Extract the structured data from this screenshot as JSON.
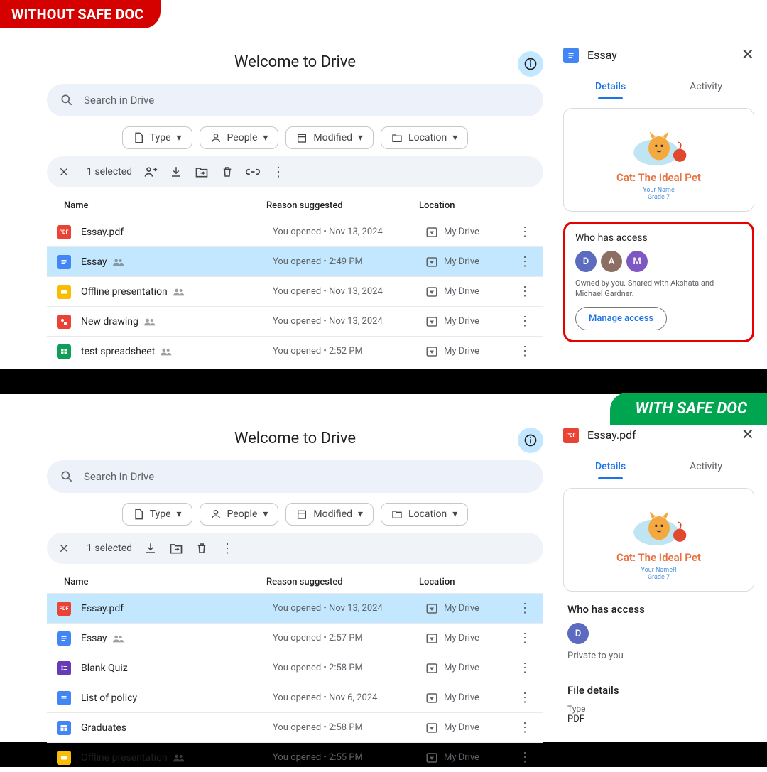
{
  "badges": {
    "without": "WITHOUT SAFE DOC",
    "with": "WITH SAFE DOC"
  },
  "top": {
    "pageTitle": "Welcome to Drive",
    "searchPlaceholder": "Search in Drive",
    "chips": {
      "type": "Type",
      "people": "People",
      "modified": "Modified",
      "location": "Location"
    },
    "selected": "1 selected",
    "headers": {
      "name": "Name",
      "reason": "Reason suggested",
      "location": "Location"
    },
    "rows": [
      {
        "name": "Essay.pdf",
        "reason": "You opened • Nov 13, 2024",
        "location": "My Drive",
        "icon": "pdf",
        "shared": false,
        "selected": false
      },
      {
        "name": "Essay",
        "reason": "You opened • 2:49 PM",
        "location": "My Drive",
        "icon": "doc",
        "shared": true,
        "selected": true
      },
      {
        "name": "Offline presentation",
        "reason": "You opened • Nov 13, 2024",
        "location": "My Drive",
        "icon": "slides",
        "shared": true,
        "selected": false
      },
      {
        "name": "New drawing",
        "reason": "You opened • Nov 13, 2024",
        "location": "My Drive",
        "icon": "draw",
        "shared": true,
        "selected": false
      },
      {
        "name": "test spreadsheet",
        "reason": "You opened • 2:52 PM",
        "location": "My Drive",
        "icon": "sheet",
        "shared": true,
        "selected": false
      }
    ],
    "side": {
      "filename": "Essay",
      "fileicon": "doc",
      "tabs": {
        "details": "Details",
        "activity": "Activity"
      },
      "preview": {
        "title": "Cat: The Ideal Pet",
        "sub1": "Your Name",
        "sub2": "Grade 7"
      },
      "access": {
        "title": "Who has access",
        "avatars": [
          {
            "letter": "D",
            "cls": "av-d"
          },
          {
            "letter": "A",
            "cls": "av-a"
          },
          {
            "letter": "M",
            "cls": "av-m"
          }
        ],
        "text": "Owned by you. Shared with Akshata and Michael Gardner.",
        "manage": "Manage access"
      }
    }
  },
  "bot": {
    "pageTitle": "Welcome to Drive",
    "searchPlaceholder": "Search in Drive",
    "chips": {
      "type": "Type",
      "people": "People",
      "modified": "Modified",
      "location": "Location"
    },
    "selected": "1 selected",
    "headers": {
      "name": "Name",
      "reason": "Reason suggested",
      "location": "Location"
    },
    "rows": [
      {
        "name": "Essay.pdf",
        "reason": "You opened • Nov 13, 2024",
        "location": "My Drive",
        "icon": "pdf",
        "shared": false,
        "selected": true
      },
      {
        "name": "Essay",
        "reason": "You opened • 2:57 PM",
        "location": "My Drive",
        "icon": "doc",
        "shared": true,
        "selected": false
      },
      {
        "name": "Blank Quiz",
        "reason": "You opened • 2:58 PM",
        "location": "My Drive",
        "icon": "form",
        "shared": false,
        "selected": false
      },
      {
        "name": "List of policy",
        "reason": "You opened • Nov 6, 2024",
        "location": "My Drive",
        "icon": "doc",
        "shared": false,
        "selected": false
      },
      {
        "name": "Graduates",
        "reason": "You opened • 2:58 PM",
        "location": "My Drive",
        "icon": "site",
        "shared": false,
        "selected": false
      },
      {
        "name": "Offline presentation",
        "reason": "You opened • 2:55 PM",
        "location": "My Drive",
        "icon": "slides",
        "shared": true,
        "selected": false
      }
    ],
    "side": {
      "filename": "Essay.pdf",
      "fileicon": "pdf",
      "tabs": {
        "details": "Details",
        "activity": "Activity"
      },
      "preview": {
        "title": "Cat: The Ideal Pet",
        "sub1": "Your NameR",
        "sub2": "Grade 7"
      },
      "access": {
        "title": "Who has access",
        "avatars": [
          {
            "letter": "D",
            "cls": "av-d"
          }
        ],
        "text": "Private to you"
      },
      "filedetails": {
        "title": "File details",
        "typeLabel": "Type",
        "typeValue": "PDF"
      }
    }
  },
  "iconClsMap": {
    "pdf": "icon-pdf",
    "doc": "icon-doc",
    "slides": "icon-slides",
    "draw": "icon-draw",
    "sheet": "icon-sheet",
    "form": "icon-form",
    "site": "icon-site"
  }
}
